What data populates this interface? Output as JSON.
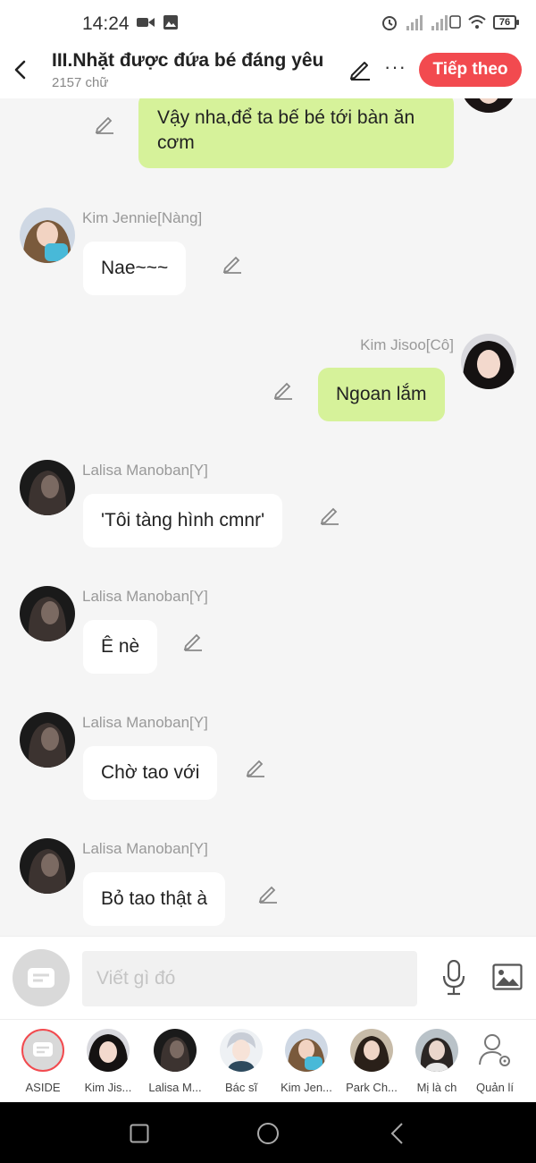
{
  "status_bar": {
    "time": "14:24",
    "battery": "76"
  },
  "header": {
    "title": "III.Nhặt được đứa bé đáng yêu",
    "subtitle": "2157 chữ",
    "next_label": "Tiếp theo"
  },
  "messages": [
    {
      "side": "right",
      "name": "",
      "text": "Vậy nha,để ta bế bé tới bàn ăn cơm"
    },
    {
      "side": "left",
      "name": "Kim Jennie[Nàng]",
      "text": "Nae~~~"
    },
    {
      "side": "right",
      "name": "Kim Jisoo[Cô]",
      "text": "Ngoan lắm"
    },
    {
      "side": "left",
      "name": "Lalisa Manoban[Y]",
      "text": "'Tôi tàng hình cmnr'"
    },
    {
      "side": "left",
      "name": "Lalisa Manoban[Y]",
      "text": "Ê nè"
    },
    {
      "side": "left",
      "name": "Lalisa Manoban[Y]",
      "text": "Chờ tao với"
    },
    {
      "side": "left",
      "name": "Lalisa Manoban[Y]",
      "text": "Bỏ tao thật à"
    }
  ],
  "message_line2": "cơm",
  "message_line1": "Vậy nha,để ta bế bé tới bàn ăn",
  "input": {
    "placeholder": "Viết gì đó"
  },
  "characters": [
    {
      "label": "ASIDE"
    },
    {
      "label": "Kim Jis..."
    },
    {
      "label": "Lalisa M..."
    },
    {
      "label": "Bác sĩ"
    },
    {
      "label": "Kim Jen..."
    },
    {
      "label": "Park Ch..."
    },
    {
      "label": "Mị là ch"
    },
    {
      "label": "Quản lí"
    }
  ],
  "colors": {
    "accent": "#f24a4f",
    "right_bubble": "#d6f29a",
    "left_bubble": "#ffffff",
    "background": "#f5f5f5"
  }
}
